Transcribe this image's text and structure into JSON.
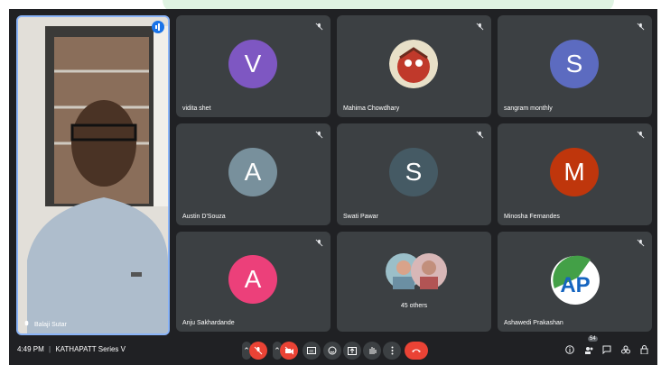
{
  "meeting": {
    "time": "4:49 PM",
    "separator": "|",
    "title": "KATHAPATT Series V"
  },
  "self_view": {
    "name": "Balaji Sutar"
  },
  "participants": [
    {
      "name": "vidita shet",
      "initial": "V",
      "color": "#7e57c2"
    },
    {
      "name": "Mahima Chowdhary",
      "initial": "",
      "color": "#9e4c3c"
    },
    {
      "name": "sangram monthly",
      "initial": "S",
      "color": "#5c6bc0"
    },
    {
      "name": "Austin D'Souza",
      "initial": "A",
      "color": "#78909c"
    },
    {
      "name": "Swati Pawar",
      "initial": "S",
      "color": "#455a64"
    },
    {
      "name": "Minosha Fernandes",
      "initial": "M",
      "color": "#bf360c"
    },
    {
      "name": "Anju Sakhardande",
      "initial": "A",
      "color": "#ec407a"
    },
    {
      "name": "Ashawedi Prakashan",
      "initial": "AP",
      "color": "#1e88e5"
    }
  ],
  "others": {
    "label": "45 others"
  },
  "participant_count": "54",
  "icons": {
    "mic_off": "mic-off-icon",
    "cam_off": "camera-off-icon",
    "captions": "captions-icon",
    "emoji": "emoji-icon",
    "present": "present-icon",
    "hand": "raise-hand-icon",
    "more": "more-icon",
    "leave": "call-end-icon",
    "info": "info-icon",
    "people": "people-icon",
    "chat": "chat-icon",
    "activities": "activities-icon",
    "lock": "lock-icon"
  }
}
